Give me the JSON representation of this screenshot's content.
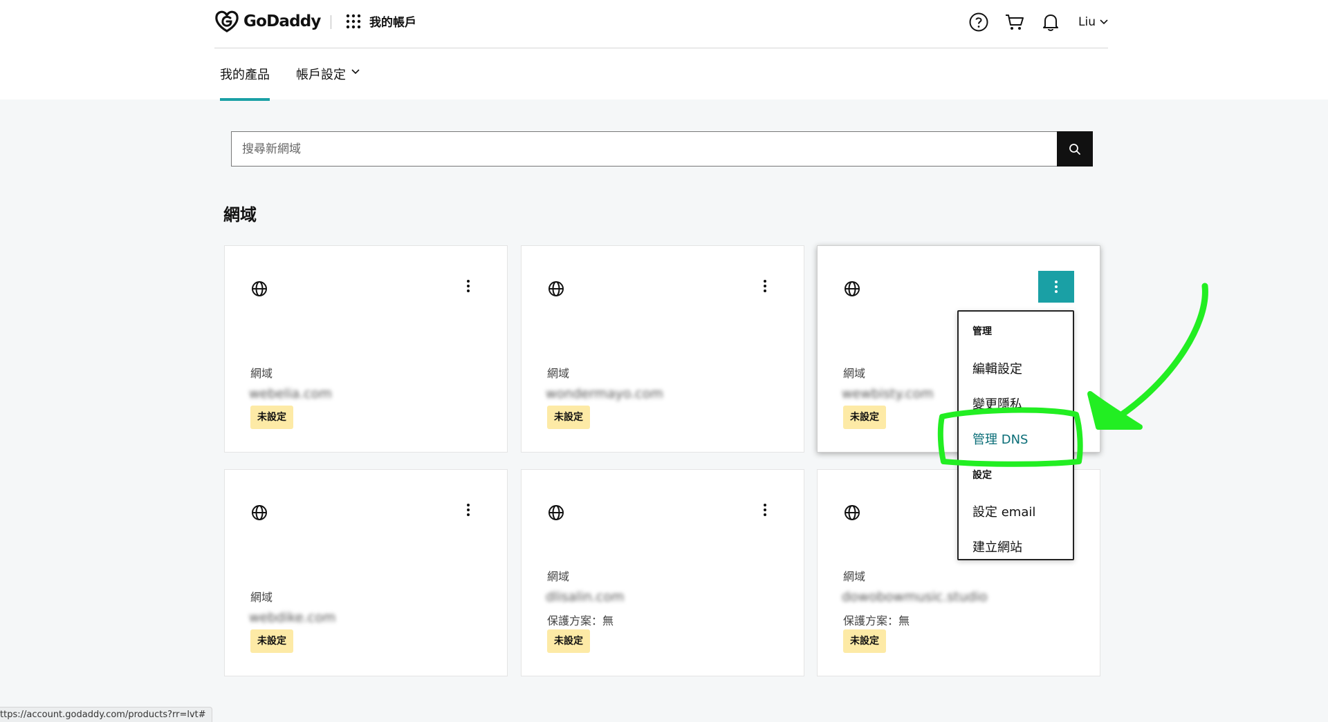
{
  "header": {
    "brand": "GoDaddy",
    "apps_label": "我的帳戶",
    "user_name": "Liu"
  },
  "subnav": {
    "items": [
      {
        "label": "我的產品",
        "active": true
      },
      {
        "label": "帳戶設定",
        "active": false
      }
    ]
  },
  "search": {
    "placeholder": "搜尋新網域"
  },
  "section": {
    "title": "網域"
  },
  "cards": [
    {
      "label": "網域",
      "domain": "webelia.com",
      "protection": "",
      "badge": "未設定"
    },
    {
      "label": "網域",
      "domain": "wondermayo.com",
      "protection": "",
      "badge": "未設定"
    },
    {
      "label": "網域",
      "domain": "wewbisty.com",
      "protection": "",
      "badge": "未設定"
    },
    {
      "label": "網域",
      "domain": "webdike.com",
      "protection": "",
      "badge": "未設定"
    },
    {
      "label": "網域",
      "domain": "dlisalin.com",
      "protection": "保護方案：無",
      "badge": "未設定"
    },
    {
      "label": "網域",
      "domain": "dowobowmusic.studio",
      "protection": "保護方案：無",
      "badge": "未設定"
    }
  ],
  "menu": {
    "group1": "管理",
    "edit": "編輯設定",
    "privacy": "變更隱私",
    "dns": "管理 DNS",
    "group2": "設定",
    "email": "設定 email",
    "website": "建立網站"
  },
  "status_url": "ttps://account.godaddy.com/products?rr=lvt#",
  "colors": {
    "accent": "#1aa0a5",
    "badge_bg": "#fdeaa6",
    "annotation": "#22ee22",
    "menu_highlight": "#0b6e78"
  },
  "icons": {
    "help": "help-circle-icon",
    "cart": "cart-icon",
    "bell": "bell-icon",
    "apps": "grid-dots-icon",
    "globe": "globe-icon",
    "kebab": "kebab-icon",
    "search": "search-icon"
  }
}
